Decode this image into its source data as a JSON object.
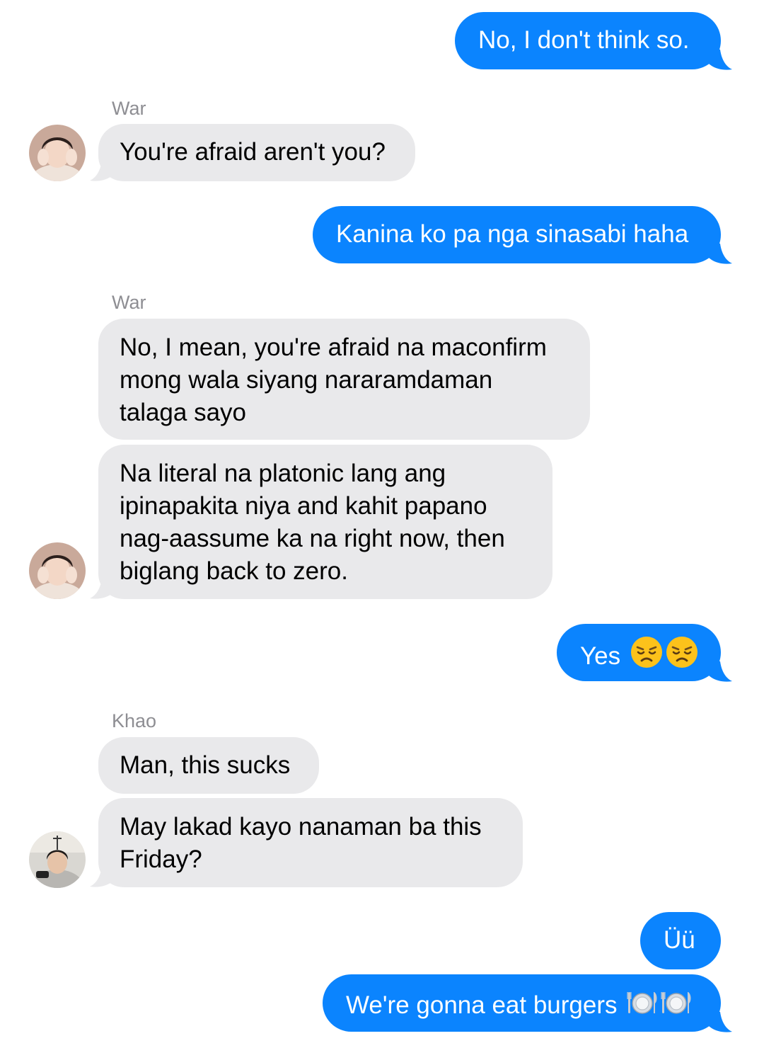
{
  "conversation": {
    "messages": [
      {
        "id": "m1",
        "direction": "outgoing",
        "text": "No, I don't think so."
      },
      {
        "id": "m2",
        "direction": "incoming",
        "sender": "War",
        "text": "You're afraid aren't you?"
      },
      {
        "id": "m3",
        "direction": "outgoing",
        "text": "Kanina ko pa nga sinasabi haha"
      },
      {
        "id": "m4",
        "direction": "incoming",
        "sender": "War",
        "lines": [
          "No, I mean, you're afraid na maconfirm",
          "mong wala siyang nararamdaman",
          "talaga sayo"
        ]
      },
      {
        "id": "m5",
        "direction": "incoming",
        "sender": "War",
        "lines": [
          "Na literal na platonic lang ang",
          "ipinapakita niya and kahit papano",
          "nag-aassume ka na right now, then",
          "biglang back to zero."
        ]
      },
      {
        "id": "m6",
        "direction": "outgoing",
        "text": "Yes",
        "emoji": [
          "disappointed-face",
          "disappointed-face"
        ]
      },
      {
        "id": "m7",
        "direction": "incoming",
        "sender": "Khao",
        "text": "Man, this sucks"
      },
      {
        "id": "m8",
        "direction": "incoming",
        "sender": "Khao",
        "lines": [
          "May lakad kayo nanaman ba this",
          "Friday?"
        ]
      },
      {
        "id": "m9",
        "direction": "outgoing",
        "text": "Üü"
      },
      {
        "id": "m10",
        "direction": "outgoing",
        "text": "We're gonna eat burgers",
        "emoji": [
          "plate-with-cutlery",
          "plate-with-cutlery"
        ]
      }
    ]
  },
  "colors": {
    "outgoing_bubble": "#0b84fe",
    "incoming_bubble": "#e9e9eb",
    "sender_name": "#8e8e93"
  }
}
